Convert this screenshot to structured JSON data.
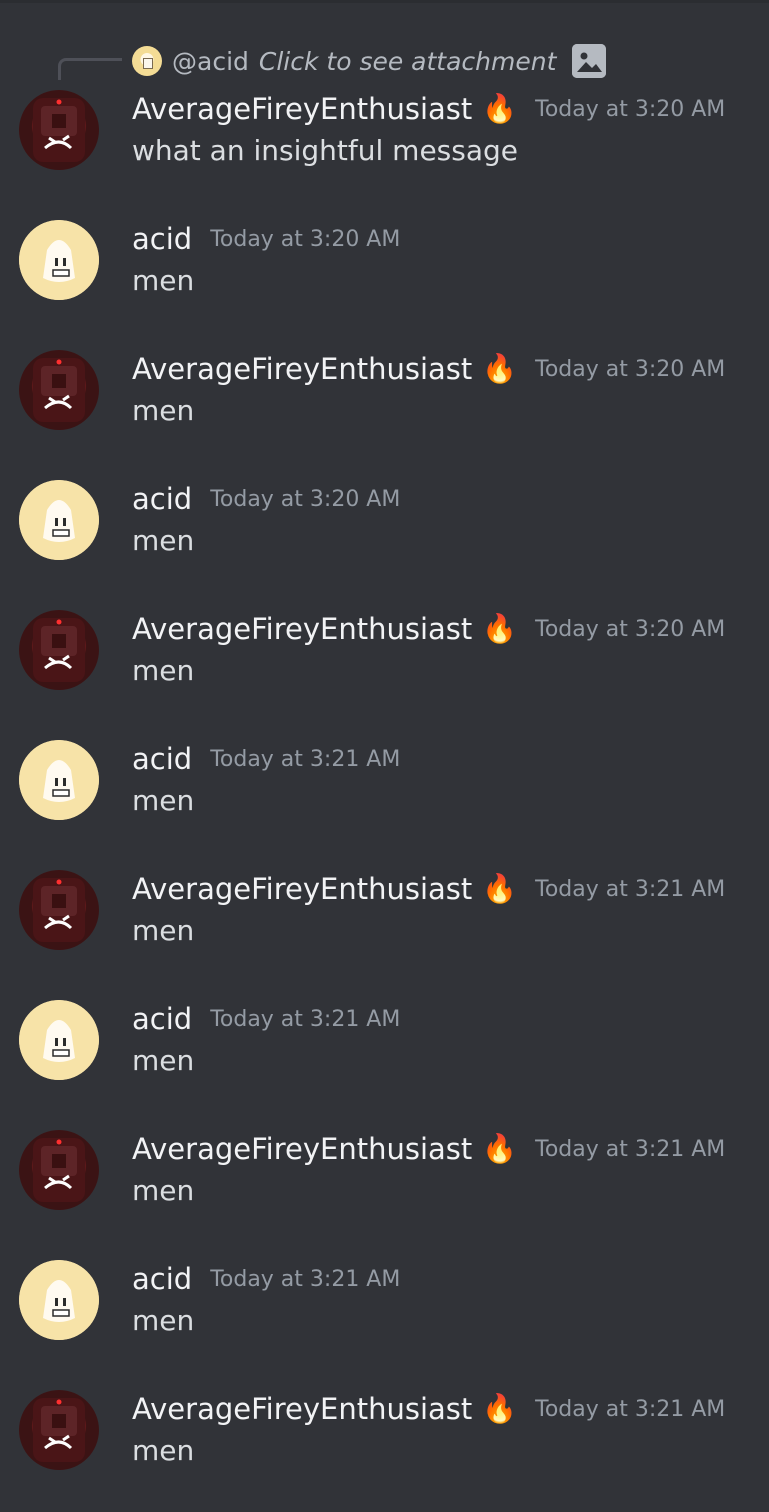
{
  "reply_preview": {
    "user": "@acid",
    "text": "Click to see attachment",
    "attachment_icon": "image-icon"
  },
  "emoji": {
    "flame": "🔥",
    "flame_icon": "fire-emoji-icon"
  },
  "colors": {
    "background": "#313338",
    "username": "#f2f3f5",
    "timestamp": "#949ba4",
    "message_text": "#dbdee1"
  },
  "messages": [
    {
      "author": "AverageFireyEnthusiast",
      "time": "Today at 3:20 AM",
      "text": "what an insightful message",
      "avatar": "firey-avatar",
      "has_emoji": true
    },
    {
      "author": "acid",
      "time": "Today at 3:20 AM",
      "text": "men",
      "avatar": "acid-avatar",
      "has_emoji": false
    },
    {
      "author": "AverageFireyEnthusiast",
      "time": "Today at 3:20 AM",
      "text": "men",
      "avatar": "firey-avatar",
      "has_emoji": true
    },
    {
      "author": "acid",
      "time": "Today at 3:20 AM",
      "text": "men",
      "avatar": "acid-avatar",
      "has_emoji": false
    },
    {
      "author": "AverageFireyEnthusiast",
      "time": "Today at 3:20 AM",
      "text": "men",
      "avatar": "firey-avatar",
      "has_emoji": true
    },
    {
      "author": "acid",
      "time": "Today at 3:21 AM",
      "text": "men",
      "avatar": "acid-avatar",
      "has_emoji": false
    },
    {
      "author": "AverageFireyEnthusiast",
      "time": "Today at 3:21 AM",
      "text": "men",
      "avatar": "firey-avatar",
      "has_emoji": true
    },
    {
      "author": "acid",
      "time": "Today at 3:21 AM",
      "text": "men",
      "avatar": "acid-avatar",
      "has_emoji": false
    },
    {
      "author": "AverageFireyEnthusiast",
      "time": "Today at 3:21 AM",
      "text": "men",
      "avatar": "firey-avatar",
      "has_emoji": true
    },
    {
      "author": "acid",
      "time": "Today at 3:21 AM",
      "text": "men",
      "avatar": "acid-avatar",
      "has_emoji": false
    },
    {
      "author": "AverageFireyEnthusiast",
      "time": "Today at 3:21 AM",
      "text": "men",
      "avatar": "firey-avatar",
      "has_emoji": true
    }
  ]
}
